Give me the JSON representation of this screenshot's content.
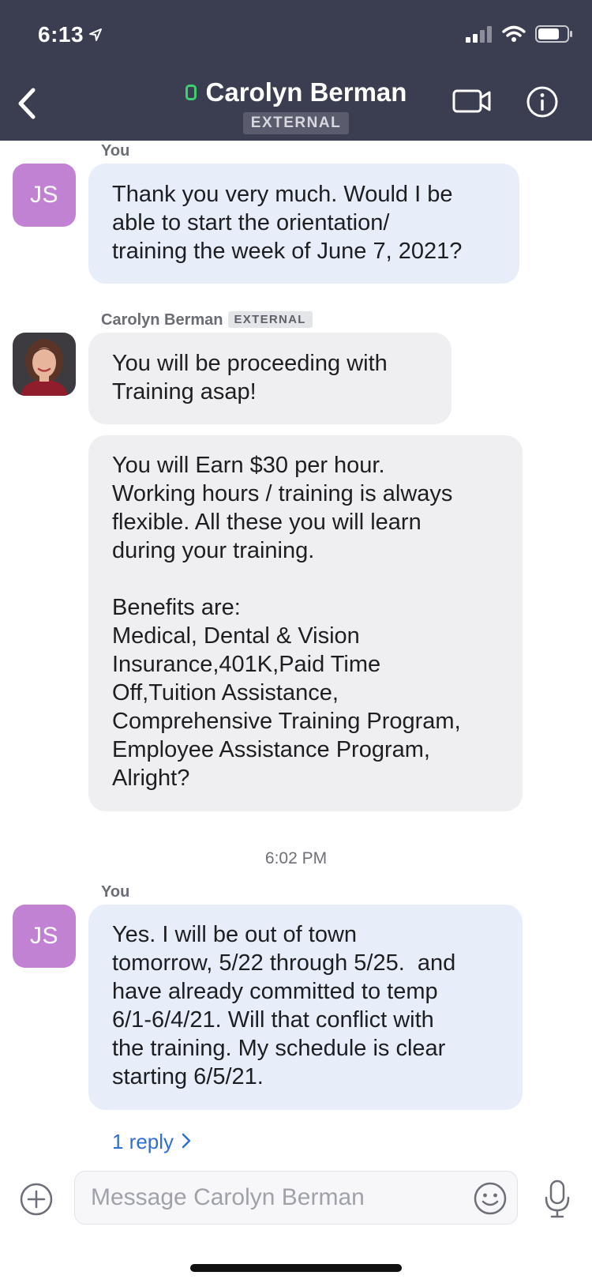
{
  "status_bar": {
    "time": "6:13"
  },
  "header": {
    "contact_name": "Carolyn Berman",
    "badge": "EXTERNAL"
  },
  "messages": [
    {
      "sender": "You",
      "avatar_initials": "JS",
      "text": "Thank you very much. Would I be\nable to start the orientation/\ntraining the week of June 7, 2021?"
    },
    {
      "sender": "Carolyn Berman",
      "badge": "EXTERNAL",
      "text": "You will be proceeding with\nTraining asap!"
    },
    {
      "sender": "Carolyn Berman",
      "text": "You will Earn $30 per hour.\nWorking hours / training is always\nflexible. All these you will learn\nduring your training.\n\nBenefits are:\nMedical, Dental & Vision\nInsurance,401K,Paid Time\nOff,Tuition Assistance,\nComprehensive Training Program,\nEmployee Assistance Program,\nAlright?"
    },
    {
      "timestamp": "6:02 PM"
    },
    {
      "sender": "You",
      "avatar_initials": "JS",
      "text": "Yes. I will be out of town\ntomorrow, 5/22 through 5/25.  and\nhave already committed to temp\n6/1-6/4/21. Will that conflict with\nthe training. My schedule is clear\nstarting 6/5/21."
    }
  ],
  "thread": {
    "reply_label": "1 reply"
  },
  "composer": {
    "placeholder": "Message Carolyn Berman"
  },
  "colors": {
    "header_bg": "#3b3d50",
    "my_bubble": "#e7eef9",
    "their_bubble": "#efeff2",
    "avatar_js": "#c182d3",
    "link": "#2f6fd4",
    "presence": "#3ecf74"
  },
  "icons": [
    "location-arrow-icon",
    "signal-icon",
    "wifi-icon",
    "battery-icon",
    "back-chevron-icon",
    "video-camera-icon",
    "info-icon",
    "chevron-right-icon",
    "add-circle-icon",
    "emoji-icon",
    "microphone-icon"
  ]
}
